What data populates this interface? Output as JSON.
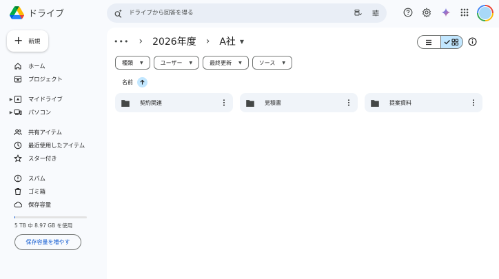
{
  "app": {
    "name": "ドライブ"
  },
  "search": {
    "placeholder": "ドライブから回答を得る"
  },
  "sidebar": {
    "new_label": "新規",
    "items": [
      {
        "label": "ホーム",
        "icon": "home-icon"
      },
      {
        "label": "プロジェクト",
        "icon": "project-icon"
      },
      {
        "label": "マイドライブ",
        "icon": "my-drive-icon"
      },
      {
        "label": "パソコン",
        "icon": "computer-icon"
      },
      {
        "label": "共有アイテム",
        "icon": "shared-icon"
      },
      {
        "label": "最近使用したアイテム",
        "icon": "recent-icon"
      },
      {
        "label": "スター付き",
        "icon": "star-icon"
      },
      {
        "label": "スパム",
        "icon": "spam-icon"
      },
      {
        "label": "ゴミ箱",
        "icon": "trash-icon"
      },
      {
        "label": "保存容量",
        "icon": "cloud-icon"
      }
    ],
    "storage_text": "5 TB 中 8.97 GB を使用",
    "storage_used_fraction": 0.0018,
    "storage_button": "保存容量を増やす"
  },
  "breadcrumb": {
    "more": "•••",
    "items": [
      "2026年度",
      "A社"
    ]
  },
  "filters": [
    "種類",
    "ユーザー",
    "最終更新",
    "ソース"
  ],
  "sort": {
    "label": "名前"
  },
  "folders": [
    "契約関連",
    "見積書",
    "提案資料"
  ],
  "colors": {
    "accent": "#0b57d0",
    "selected": "#c2e7ff",
    "surface": "#f0f4f9"
  }
}
